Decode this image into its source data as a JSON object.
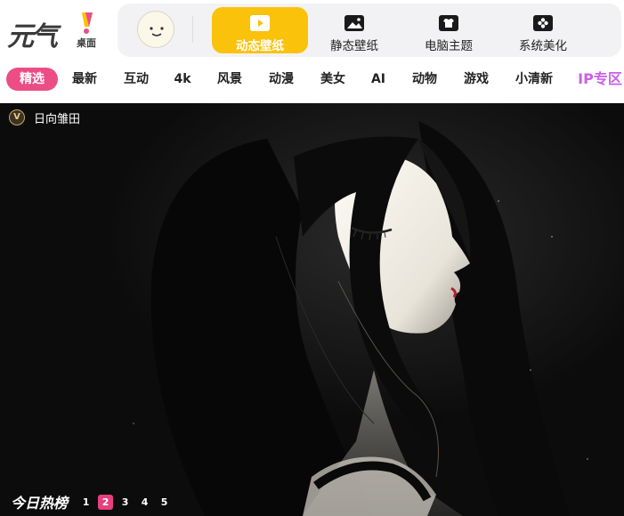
{
  "logo": {
    "main": "元气",
    "sub": "桌面"
  },
  "header": {
    "avatar_icon": "smiley-face-icon",
    "nav": [
      {
        "label": "动态壁纸",
        "icon": "play-icon",
        "active": true
      },
      {
        "label": "静态壁纸",
        "icon": "image-icon",
        "active": false
      },
      {
        "label": "电脑主题",
        "icon": "shirt-icon",
        "active": false
      },
      {
        "label": "系统美化",
        "icon": "flower-icon",
        "active": false
      }
    ]
  },
  "categories": [
    "精选",
    "最新",
    "互动",
    "4k",
    "风景",
    "动漫",
    "美女",
    "AI",
    "动物",
    "游戏",
    "小清新",
    "IP专区"
  ],
  "active_category": "精选",
  "banner": {
    "author_badge": "V",
    "author": "日向雏田",
    "hot_title": "今日热榜",
    "pages": [
      "1",
      "2",
      "3",
      "4",
      "5"
    ],
    "active_page": "2"
  },
  "colors": {
    "accent_yellow": "#fbc20c",
    "accent_pink": "#ec4d84",
    "ip_purple": "#cd5fe6"
  }
}
